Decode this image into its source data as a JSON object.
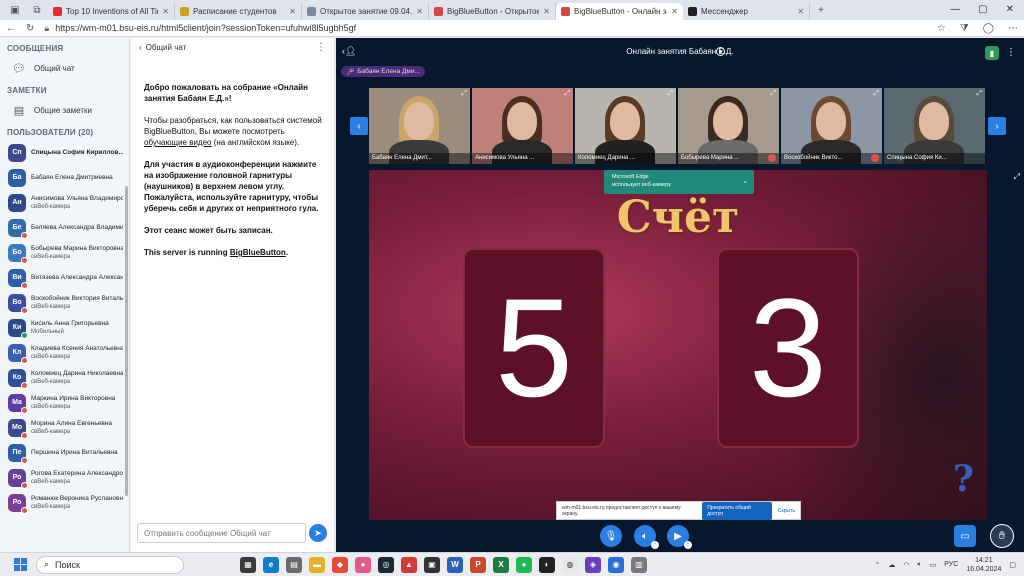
{
  "browser": {
    "tabs": [
      {
        "title": "Top 10 Inventions of All Time - Y",
        "color": "#e52d27",
        "active": false
      },
      {
        "title": "Расписание студентов",
        "color": "#c9a227",
        "active": false
      },
      {
        "title": "Открытое занятие 09.04.2024 Бі",
        "color": "#7b8a9a",
        "active": false
      },
      {
        "title": "BigBlueButton - Открытое",
        "color": "#d64545",
        "active": false
      },
      {
        "title": "BigBlueButton - Онлайн за",
        "color": "#d64545",
        "active": true
      },
      {
        "title": "Мессенджер",
        "color": "#222222",
        "active": false
      }
    ],
    "url": "https://wm-m01.bsu-eis.ru/html5client/join?sessionToken=ufuhwi8l5ugbh5gf"
  },
  "sidebar": {
    "messages_title": "СООБЩЕНИЯ",
    "public_chat": "Общий чат",
    "notes_title": "ЗАМЕТКИ",
    "shared_notes": "Общие заметки",
    "users_title": "ПОЛЬЗОВАТЕЛИ (20)",
    "users": [
      {
        "initials": "Сп",
        "name": "Спицына София Кириллов... (Вы)",
        "sub": "",
        "color": "#3b4a8f",
        "me": true,
        "badge": ""
      },
      {
        "initials": "Ба",
        "name": "Бабаян Елена Дмитриевна",
        "sub": "",
        "color": "#2b5fa8",
        "me": false,
        "badge": ""
      },
      {
        "initials": "Ан",
        "name": "Анисимова Ульяна Владимиро...",
        "sub": "свВеб-камера",
        "color": "#2e4a8a",
        "me": false,
        "badge": ""
      },
      {
        "initials": "Бе",
        "name": "Беляева Александра Владими...",
        "sub": "",
        "color": "#2e6fa8",
        "me": false,
        "badge": "red"
      },
      {
        "initials": "Бо",
        "name": "Бобырева Марина Викторовна",
        "sub": "свВеб-камера",
        "color": "#3a7bc0",
        "me": false,
        "badge": "red"
      },
      {
        "initials": "Ви",
        "name": "Витязева Александра Александ...",
        "sub": "",
        "color": "#2e5fa8",
        "me": false,
        "badge": "red"
      },
      {
        "initials": "Во",
        "name": "Воскобойник Виктория Виталь...",
        "sub": "свВеб-камера",
        "color": "#3a4fa0",
        "me": false,
        "badge": "red"
      },
      {
        "initials": "Ки",
        "name": "Кисиль Анна Григорьевна",
        "sub": "Мобильный",
        "color": "#2b4a8a",
        "me": false,
        "badge": "green"
      },
      {
        "initials": "Кл",
        "name": "Кладиева Ксения Анатольевна",
        "sub": "свВеб-камера",
        "color": "#3a5fb0",
        "me": false,
        "badge": "red"
      },
      {
        "initials": "Ко",
        "name": "Коломиец Дарина Николаевна",
        "sub": "свВеб-камера",
        "color": "#2e4f9a",
        "me": false,
        "badge": "red"
      },
      {
        "initials": "Ма",
        "name": "Маркина Ирина Викторовна",
        "sub": "свВеб-камера",
        "color": "#5a3fa0",
        "me": false,
        "badge": "red"
      },
      {
        "initials": "Мо",
        "name": "Морина Алина Евгеньевна",
        "sub": "свВеб-камера",
        "color": "#3b4a8f",
        "me": false,
        "badge": "red"
      },
      {
        "initials": "Пе",
        "name": "Першина Ирина Витальевна",
        "sub": "",
        "color": "#2e5fa8",
        "me": false,
        "badge": "red"
      },
      {
        "initials": "Ро",
        "name": "Рогова Екатерина Александро...",
        "sub": "свВеб-камера",
        "color": "#6a3f9a",
        "me": false,
        "badge": "red"
      },
      {
        "initials": "Ро",
        "name": "Романюк Вероника Руслановна",
        "sub": "свВеб-камера",
        "color": "#7a3f9a",
        "me": false,
        "badge": "red"
      }
    ]
  },
  "chat": {
    "header": "Общий чат",
    "welcome_1": "Добро пожаловать на собрание «Онлайн занятия Бабаян Е.Д.»!",
    "p2_a": "Чтобы разобраться, как пользоваться системой BigBlueButton, Вы можете посмотреть ",
    "p2_link": "обучающие видео",
    "p2_b": " (на английском языке).",
    "p3": "Для участия в аудиоконференции нажмите на изображение головной гарнитуры (наушников) в верхнем левом углу. Пожалуйста, используйте гарнитуру, чтобы уберечь себя и других от неприятного гула.",
    "p4": "Этот сеанс может быть записан.",
    "p5_a": "This server is running ",
    "p5_link": "BigBlueButton",
    "p5_b": ".",
    "input_placeholder": "Отправить сообщение Общий чат"
  },
  "main": {
    "meeting_title": "Онлайн занятия Бабаян Е.Д.",
    "presenter": "Бабаян Елена Дми...",
    "videos": [
      {
        "name": "Бабаян Елена Дмит...",
        "bg": "#9c8c7e",
        "hair": "#c9a56a",
        "body": "#3a3a3a",
        "muted": false
      },
      {
        "name": "Анисимова Ульяна ...",
        "bg": "#c0807a",
        "hair": "#4a2e22",
        "body": "#2a2a2a",
        "muted": false
      },
      {
        "name": "Коломиец Дарина ...",
        "bg": "#b8b4ae",
        "hair": "#5a3a25",
        "body": "#222222",
        "muted": false
      },
      {
        "name": "Бобырева Марина ...",
        "bg": "#a59a8c",
        "hair": "#3a2a20",
        "body": "#6a6a6a",
        "muted": true
      },
      {
        "name": "Воскобойник Викто...",
        "bg": "#8c96a5",
        "hair": "#6a4a30",
        "body": "#2a2a2a",
        "muted": true
      },
      {
        "name": "Спицына София Ки...",
        "bg": "#5a6a70",
        "hair": "#5a4a3a",
        "body": "#3a3a3a",
        "muted": false
      }
    ],
    "slide_title": "Счёт",
    "score_left": "5",
    "score_right": "3",
    "help_mark": "?",
    "notify_line1": "Microsoft Edge",
    "notify_line2": "использует веб-камеру",
    "share_text": "wm-m01.bsu-eis.ru предоставляет доступ к вашему экрану.",
    "share_stop": "Прекратить общий доступ",
    "share_hide": "Скрыть"
  },
  "taskbar": {
    "search_placeholder": "Поиск",
    "lang": "РУС",
    "time": "14:21",
    "date": "16.04.2024"
  },
  "colors": {
    "accent": "#2a7fe3",
    "slide_bg": "#7b1e3c",
    "title_gold": "#f0c46a"
  }
}
